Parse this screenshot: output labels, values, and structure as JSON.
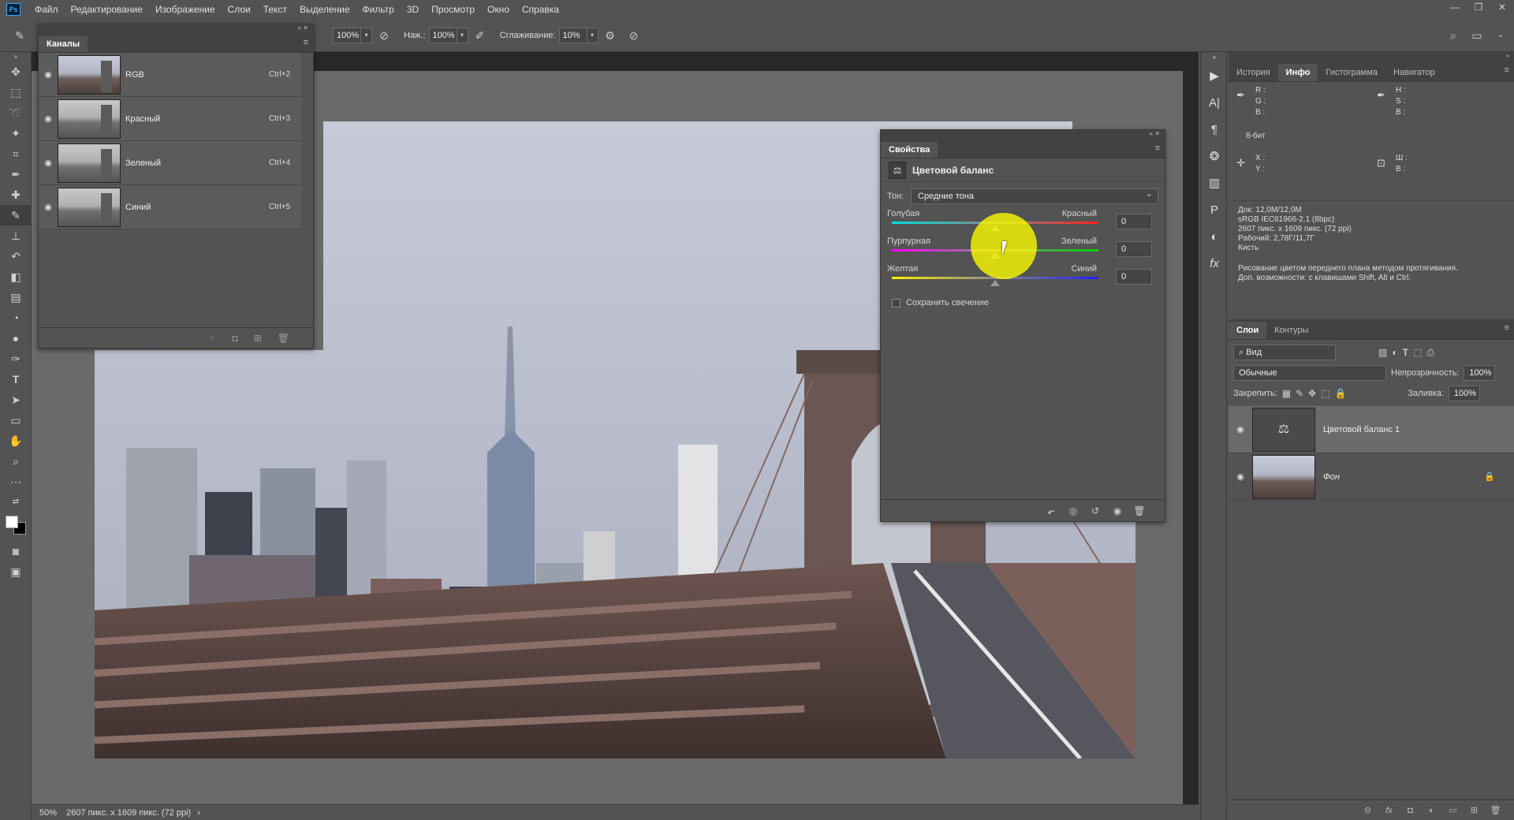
{
  "menu": {
    "logo": "Ps",
    "items": [
      "Файл",
      "Редактирование",
      "Изображение",
      "Слои",
      "Текст",
      "Выделение",
      "Фильтр",
      "3D",
      "Просмотр",
      "Окно",
      "Справка"
    ]
  },
  "options": {
    "size_value": "100%",
    "press_label": "Наж.:",
    "press_value": "100%",
    "smooth_label": "Сглаживание:",
    "smooth_value": "10%"
  },
  "channels": {
    "tab": "Каналы",
    "rows": [
      {
        "name": "RGB",
        "key": "Ctrl+2"
      },
      {
        "name": "Красный",
        "key": "Ctrl+3"
      },
      {
        "name": "Зеленый",
        "key": "Ctrl+4"
      },
      {
        "name": "Синий",
        "key": "Ctrl+5"
      }
    ]
  },
  "properties": {
    "tab": "Свойства",
    "title": "Цветовой баланс",
    "tone_label": "Тон:",
    "tone_value": "Средние тона",
    "sliders": [
      {
        "left": "Голубая",
        "right": "Красный",
        "value": "0"
      },
      {
        "left": "Пурпурная",
        "right": "Зеленый",
        "value": "0"
      },
      {
        "left": "Желтая",
        "right": "Синий",
        "value": "0"
      }
    ],
    "preserve_label": "Сохранить свечение"
  },
  "info": {
    "tabs": [
      "История",
      "Инфо",
      "Гистограмма",
      "Навигатор"
    ],
    "r_label": "R :",
    "g_label": "G :",
    "b_label": "B :",
    "bit": "8-бит",
    "h_label": "H :",
    "s_label": "S :",
    "b2_label": "B :",
    "x_label": "X :",
    "y_label": "Y :",
    "w_label": "Ш :",
    "hgt_label": "В :",
    "doc_line1": "Док: 12,0M/12,0M",
    "doc_line2": "sRGB IEC61966-2.1 (8bpc)",
    "doc_line3": "2607 пикс. x 1609 пикс. (72 ppi)",
    "doc_line4": "Рабочий: 2,78Г/11,7Г",
    "doc_line5": "Кисть",
    "hint_line1": "Рисование цветом переднего плана методом протягивания.",
    "hint_line2": "Доп. возможности: с клавишами Shift, Alt и Ctrl."
  },
  "layers": {
    "tabs": [
      "Слои",
      "Контуры"
    ],
    "filter": "Вид",
    "blend": "Обычные",
    "opacity_label": "Непрозрачность:",
    "opacity_value": "100%",
    "lock_label": "Закрепить:",
    "fill_label": "Заливка:",
    "fill_value": "100%",
    "items": [
      {
        "name": "Цветовой баланс 1"
      },
      {
        "name": "Фон"
      }
    ]
  },
  "status": {
    "zoom": "50%",
    "doc": "2607 пикс. x 1609 пикс. (72 ppi)"
  },
  "colors": {
    "ui_bg": "#535353",
    "canvas_bg": "#6a6a6a",
    "highlight": "#ffff00"
  }
}
